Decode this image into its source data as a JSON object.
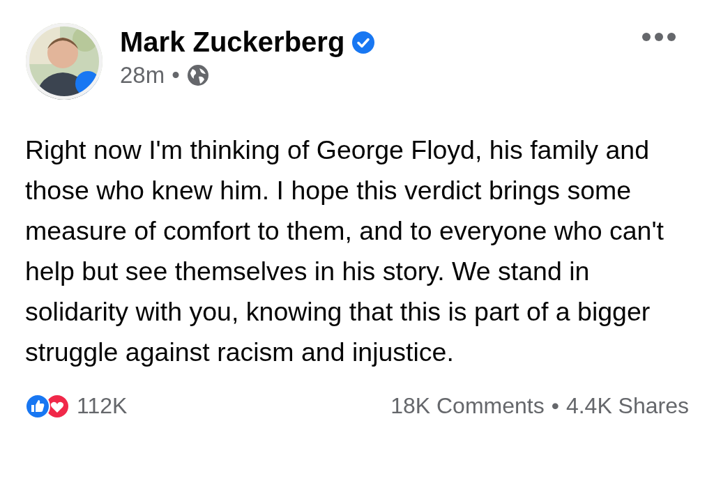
{
  "post": {
    "author": "Mark Zuckerberg",
    "verified": true,
    "time": "28m",
    "separator": "•",
    "text": "Right now I'm thinking of George Floyd, his family and those who knew him. I hope this verdict brings some measure of comfort to them, and to everyone who can't help but see themselves in his story. We stand in solidarity with you, knowing that this is part of a bigger struggle against racism and injustice."
  },
  "footer": {
    "reactions_count": "112K",
    "comments": "18K Comments",
    "separator": "•",
    "shares": "4.4K Shares"
  }
}
